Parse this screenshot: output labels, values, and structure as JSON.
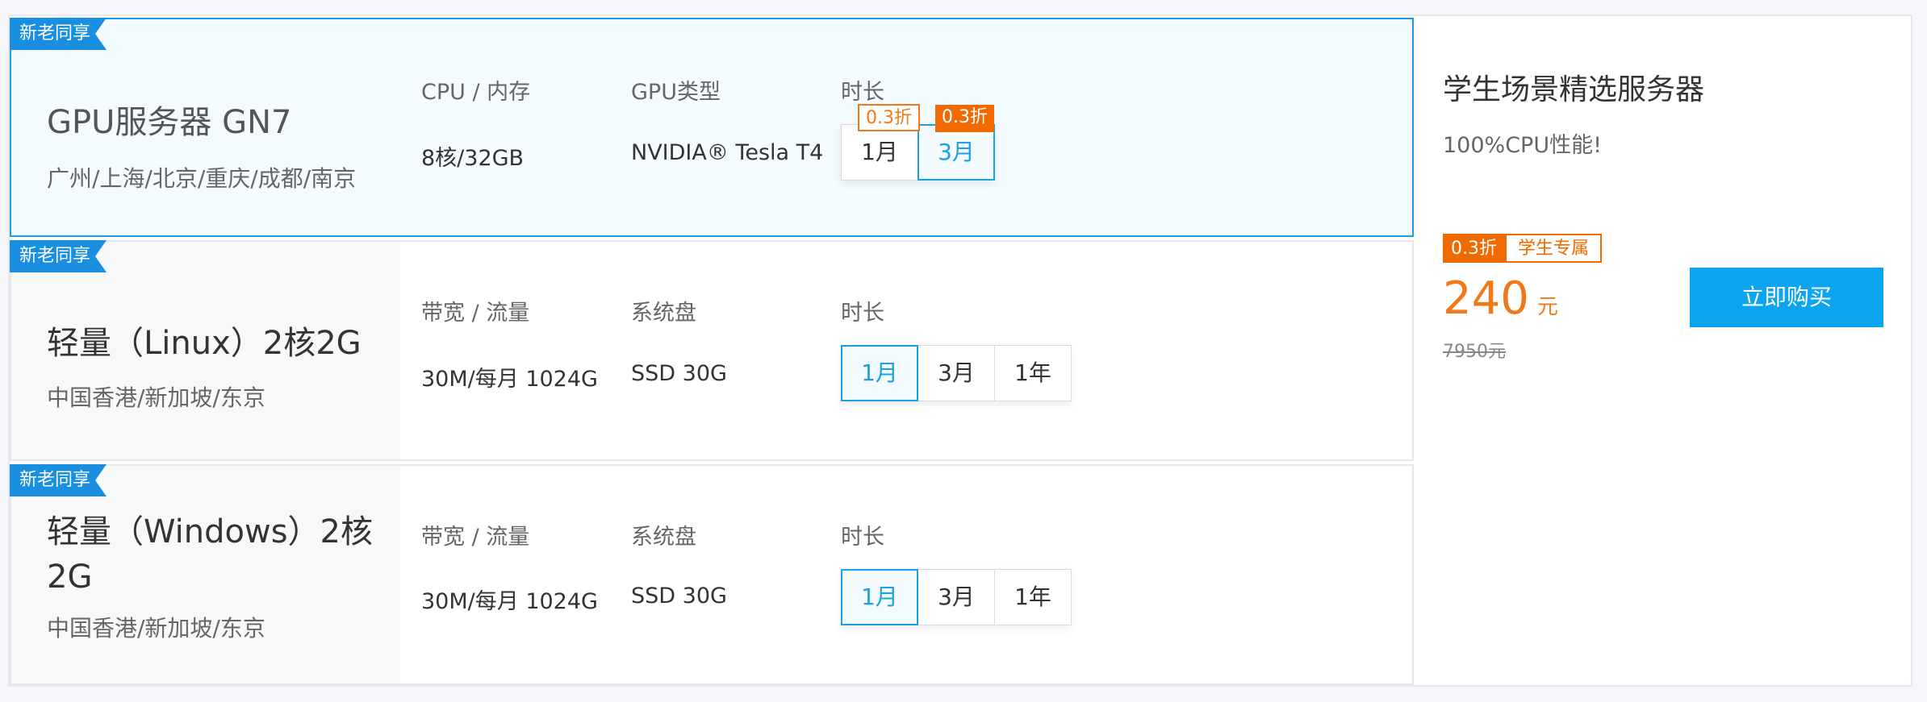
{
  "products": [
    {
      "ribbon": "新老同享",
      "title": "GPU服务器 GN7",
      "regions": "广州/上海/北京/重庆/成都/南京",
      "spec1_label": "CPU / 内存",
      "spec1_value": "8核/32GB",
      "spec2_label": "GPU类型",
      "spec2_value": "NVIDIA® Tesla T4",
      "duration_label": "时长",
      "durations": [
        {
          "label": "1月",
          "discount": "0.3折"
        },
        {
          "label": "3月",
          "discount": "0.3折",
          "selected": true
        }
      ]
    },
    {
      "ribbon": "新老同享",
      "title": "轻量（Linux）2核2G",
      "regions": "中国香港/新加坡/东京",
      "spec1_label": "带宽 / 流量",
      "spec1_value": "30M/每月 1024G",
      "spec2_label": "系统盘",
      "spec2_value": "SSD 30G",
      "duration_label": "时长",
      "durations": [
        {
          "label": "1月",
          "selected": true
        },
        {
          "label": "3月"
        },
        {
          "label": "1年"
        }
      ]
    },
    {
      "ribbon": "新老同享",
      "title": "轻量（Windows）2核2G",
      "regions": "中国香港/新加坡/东京",
      "spec1_label": "带宽 / 流量",
      "spec1_value": "30M/每月 1024G",
      "spec2_label": "系统盘",
      "spec2_value": "SSD 30G",
      "duration_label": "时长",
      "durations": [
        {
          "label": "1月",
          "selected": true
        },
        {
          "label": "3月"
        },
        {
          "label": "1年"
        }
      ]
    }
  ],
  "promo": {
    "title": "学生场景精选服务器",
    "subtitle": "100%CPU性能!",
    "discount_tag": "0.3折",
    "audience_tag": "学生专属",
    "price": "240",
    "price_unit": "元",
    "original_price": "7950元",
    "buy_label": "立即购买"
  },
  "colors": {
    "accent_blue": "#1aa0e6",
    "ribbon_blue": "#1a8fe0",
    "discount_orange": "#f06a00",
    "buy_button": "#0aa5ee"
  }
}
